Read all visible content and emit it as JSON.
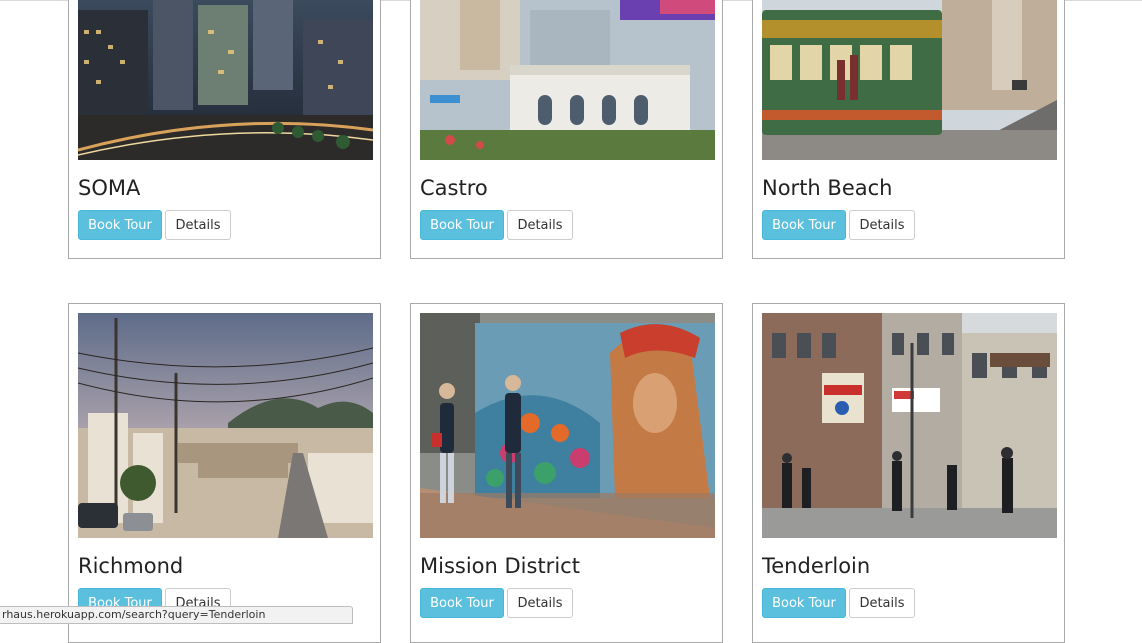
{
  "neighborhoods": [
    {
      "name": "SOMA",
      "book_label": "Book Tour",
      "details_label": "Details"
    },
    {
      "name": "Castro",
      "book_label": "Book Tour",
      "details_label": "Details"
    },
    {
      "name": "North Beach",
      "book_label": "Book Tour",
      "details_label": "Details"
    },
    {
      "name": "Richmond",
      "book_label": "Book Tour",
      "details_label": "Details"
    },
    {
      "name": "Mission District",
      "book_label": "Book Tour",
      "details_label": "Details"
    },
    {
      "name": "Tenderloin",
      "book_label": "Book Tour",
      "details_label": "Details"
    }
  ],
  "status_bar": {
    "url": "rhaus.herokuapp.com/search?query=Tenderloin"
  },
  "colors": {
    "book_button": "#5bc0de",
    "card_border": "#aaaaaa"
  }
}
